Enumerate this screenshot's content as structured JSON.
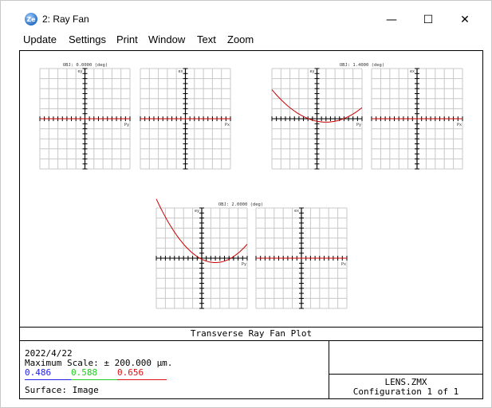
{
  "window": {
    "title": "2: Ray Fan",
    "app_icon_text": "Ze",
    "controls": {
      "minimize": "—",
      "maximize": "☐",
      "close": "✕"
    }
  },
  "menu": [
    "Update",
    "Settings",
    "Print",
    "Window",
    "Text",
    "Zoom"
  ],
  "plot": {
    "title": "Transverse Ray Fan Plot",
    "date": "2022/4/22",
    "max_scale": "Maximum Scale: ± 200.000 µm.",
    "wavelengths": [
      {
        "label": "0.486",
        "color": "#1f1fe6"
      },
      {
        "label": "0.588",
        "color": "#22cc22"
      },
      {
        "label": "0.656",
        "color": "#dd1111"
      }
    ],
    "surface": "Surface: Image",
    "lens_file": "LENS.ZMX",
    "configuration": "Configuration 1 of 1",
    "fields": [
      {
        "label": "OBJ: 0.0000 (deg)",
        "tangential": {
          "ey_label": "ey",
          "py_label": "Py"
        },
        "sagittal": {
          "ex_label": "ex",
          "px_label": "Px"
        }
      },
      {
        "label": "OBJ: 1.4000 (deg)",
        "tangential": {
          "ey_label": "ey",
          "py_label": "Py"
        },
        "sagittal": {
          "ex_label": "ex",
          "px_label": "Px"
        }
      },
      {
        "label": "OBJ: 2.0000 (deg)",
        "tangential": {
          "ey_label": "ey",
          "py_label": "Py"
        },
        "sagittal": {
          "ex_label": "ex",
          "px_label": "Px"
        }
      }
    ]
  },
  "colors": {
    "grid": "#c8c8c8",
    "axis": "#000000",
    "curve": "#cc0000"
  }
}
